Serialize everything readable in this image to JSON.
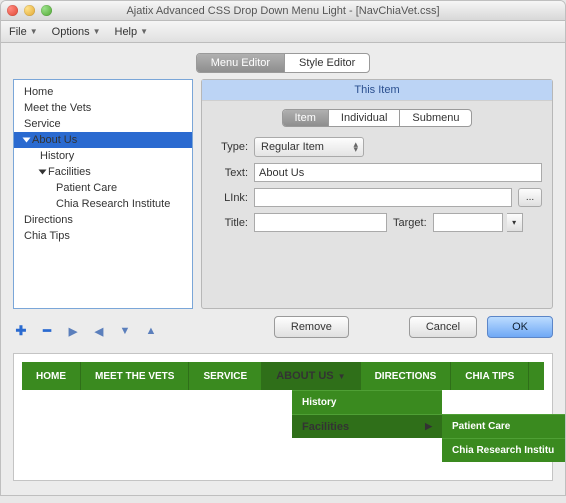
{
  "window_title": "Ajatix Advanced CSS Drop Down Menu Light - [NavChiaVet.css]",
  "menubar": {
    "file": "File",
    "options": "Options",
    "help": "Help"
  },
  "tabs": {
    "menu_editor": "Menu Editor",
    "style_editor": "Style Editor"
  },
  "tree": {
    "home": "Home",
    "meet": "Meet the Vets",
    "service": "Service",
    "about": "About Us",
    "history": "History",
    "facilities": "Facilities",
    "patient": "Patient Care",
    "research": "Chia Research Institute",
    "directions": "Directions",
    "tips": "Chia Tips"
  },
  "panel": {
    "header": "This Item",
    "subtabs": {
      "item": "Item",
      "individual": "Individual",
      "submenu": "Submenu"
    },
    "labels": {
      "type": "Type:",
      "text": "Text:",
      "link": "LInk:",
      "title": "Title:",
      "target": "Target:"
    },
    "type_value": "Regular Item",
    "text_value": "About Us",
    "link_value": "",
    "title_value": "",
    "target_value": "",
    "browse": "..."
  },
  "buttons": {
    "remove": "Remove",
    "cancel": "Cancel",
    "ok": "OK"
  },
  "preview_nav": {
    "home": "HOME",
    "meet": "MEET THE VETS",
    "service": "SERVICE",
    "about": "ABOUT US",
    "directions": "DIRECTIONS",
    "tips": "CHIA TIPS",
    "sub_history": "History",
    "sub_facilities": "Facilities",
    "sub2_patient": "Patient Care",
    "sub2_research": "Chia Research Institu"
  }
}
